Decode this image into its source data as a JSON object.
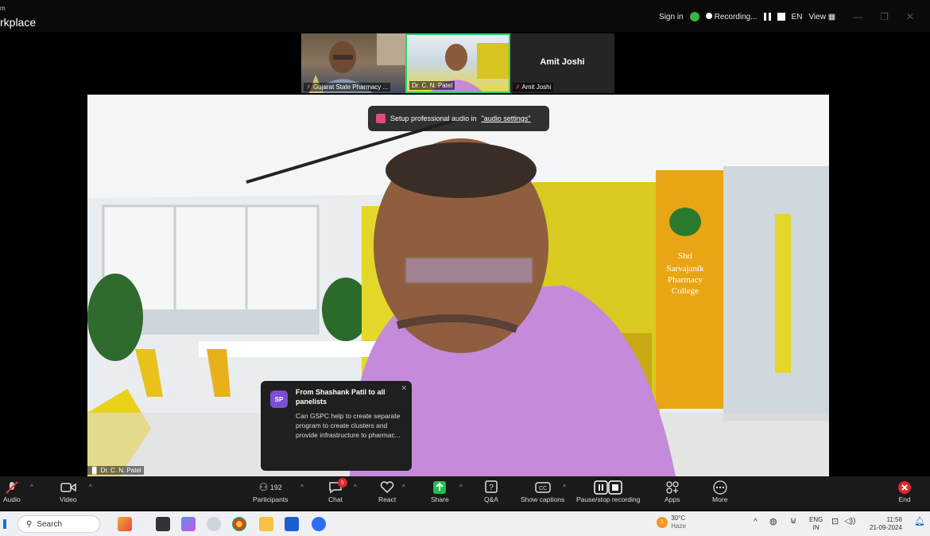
{
  "window": {
    "app_name_top": "m",
    "app_name": "rkplace"
  },
  "topbar": {
    "sign_in": "Sign in",
    "recording": "Recording...",
    "lang": "EN",
    "view": "View"
  },
  "thumbnails": [
    {
      "name": "Gujarat State Pharmacy ..."
    },
    {
      "name": "Dr. C. N. Patel"
    },
    {
      "name": "Amit Joshi",
      "title": "Amit Joshi"
    }
  ],
  "toast": {
    "text": "Setup professional audio in ",
    "link": "\"audio settings\""
  },
  "chat_popup": {
    "avatar": "SP",
    "from": "From Shashank Patil to all panelists",
    "message": "Can GSPC help to create separate program to create clusters and provide infrastructure to pharmac..."
  },
  "video": {
    "speaker_label": "Dr. C. N. Patel",
    "college_line1": "Shri",
    "college_line2": "Sarvajanik",
    "college_line3": "Pharmacy",
    "college_line4": "College"
  },
  "toolbar": {
    "audio": "Audio",
    "video": "Video",
    "participants": "Participants",
    "participants_count": "192",
    "chat": "Chat",
    "chat_badge": "5",
    "react": "React",
    "share": "Share",
    "qa": "Q&A",
    "captions": "Show captions",
    "record": "Pause/stop recording",
    "apps": "Apps",
    "more": "More",
    "end": "End"
  },
  "taskbar": {
    "search": "Search",
    "weather_temp": "30°C",
    "weather_desc": "Haze",
    "lang1": "ENG",
    "lang2": "IN",
    "time": "11:56",
    "date": "21-09-2024",
    "weather_badge": "1"
  },
  "colors": {
    "toolbar_bg": "#1a1a1a",
    "share_green": "#1fbf4a",
    "end_red": "#e02828",
    "chat_badge": "#e02828",
    "thumb_active": "#2bd56b"
  }
}
